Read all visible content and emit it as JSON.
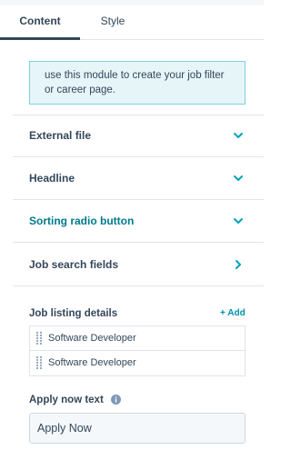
{
  "tabs": [
    {
      "label": "Content",
      "active": true
    },
    {
      "label": "Style",
      "active": false
    }
  ],
  "notice": {
    "text": "use this module to create your job filter or career page."
  },
  "sections": [
    {
      "label": "External file",
      "icon": "chevron-down-icon"
    },
    {
      "label": "Headline",
      "icon": "chevron-down-icon"
    },
    {
      "label": "Sorting radio button",
      "icon": "chevron-down-icon"
    },
    {
      "label": "Job search fields",
      "icon": "chevron-right-icon"
    }
  ],
  "job_listing": {
    "label": "Job listing details",
    "add_label": "+ Add",
    "items": [
      "Software Developer",
      "Software Developer"
    ]
  },
  "apply_now": {
    "label": "Apply now text",
    "value": "Apply Now"
  },
  "colors": {
    "accent": "#00a4bd",
    "teal_text": "#007a8c",
    "link": "#0091ae",
    "text": "#33475b",
    "notice_bg": "#e5f5f8",
    "notice_border": "#7fd1de",
    "border": "#dfe3eb"
  }
}
